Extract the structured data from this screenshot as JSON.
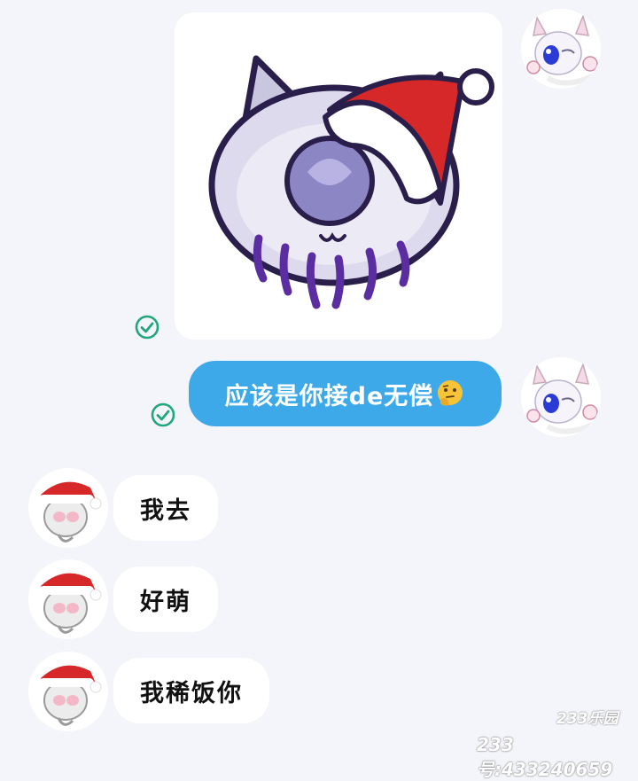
{
  "messages": [
    {
      "id": "m1",
      "direction": "sent",
      "kind": "sticker",
      "sticker": "purple-cat-santa-hat-sticker",
      "status": "read",
      "status_icon": "check-circle-icon"
    },
    {
      "id": "m2",
      "direction": "sent",
      "kind": "text",
      "text": "应该是你接de无偿",
      "emoji": "thinking-face-icon",
      "status": "read",
      "status_icon": "check-circle-icon"
    },
    {
      "id": "m3",
      "direction": "received",
      "kind": "text",
      "text": "我去"
    },
    {
      "id": "m4",
      "direction": "received",
      "kind": "text",
      "text": "好萌"
    },
    {
      "id": "m5",
      "direction": "received",
      "kind": "text",
      "text": "我稀饭你"
    }
  ],
  "avatars": {
    "self": "anime-cat-avatar-icon",
    "other": "santa-hat-avatar-icon"
  },
  "watermark": {
    "logo": "233乐园",
    "id_line": "233号:433240659"
  },
  "colors": {
    "background": "#f4f5fb",
    "sent_bubble": "#3ea9e8",
    "received_bubble": "#ffffff",
    "read_check": "#1fa67a",
    "santa_red": "#d62828"
  }
}
